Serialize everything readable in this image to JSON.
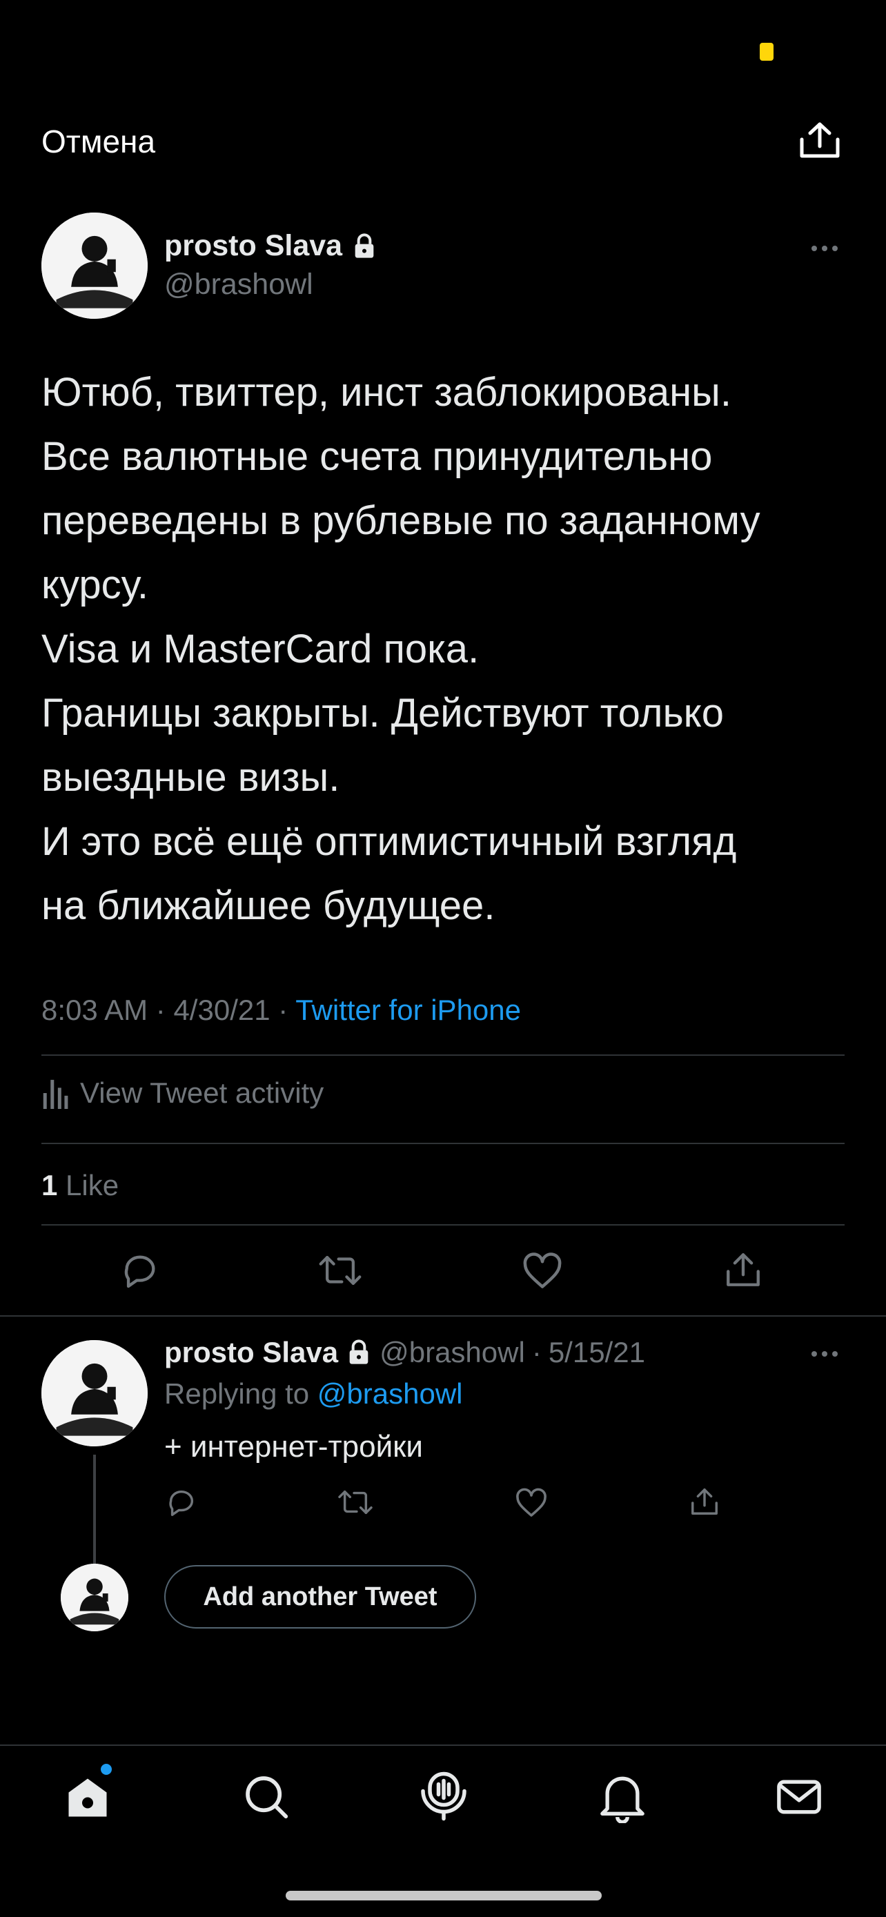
{
  "status_bar": {
    "battery_color": "#ffd60a"
  },
  "header": {
    "cancel_label": "Отмена",
    "share_icon": "share-icon"
  },
  "tweet": {
    "display_name": "prosto Slava",
    "handle": "@brashowl",
    "lines": [
      "Ютюб, твиттер, инст заблокированы.",
      "Все валютные счета принудительно",
      "переведены в рублевые по заданному",
      "курсу.",
      "Visa и MasterCard пока.",
      "Границы закрыты. Действуют только",
      "выездные визы.",
      "И это всё ещё оптимистичный взгляд",
      "на ближайшее будущее."
    ],
    "time": "8:03 AM",
    "date": "4/30/21",
    "sep": "·",
    "source": "Twitter for iPhone",
    "activity_label": "View Tweet activity",
    "likes_count": "1",
    "likes_label": "Like"
  },
  "reply": {
    "display_name": "prosto Slava",
    "handle": "@brashowl",
    "date": "5/15/21",
    "sep": "·",
    "replying_prefix": "Replying to",
    "replying_handle": "@brashowl",
    "text": "+ интернет-тройки"
  },
  "compose": {
    "add_another_label": "Add another Tweet"
  },
  "tab_bar": {
    "items": [
      "home-icon",
      "search-icon",
      "spaces-icon",
      "notifications-icon",
      "messages-icon"
    ],
    "home_dot_color": "#1d9bf0"
  },
  "colors": {
    "accent": "#1d9bf0",
    "text": "#e7e9ea",
    "muted": "#71767b",
    "divider": "#2f3336"
  }
}
